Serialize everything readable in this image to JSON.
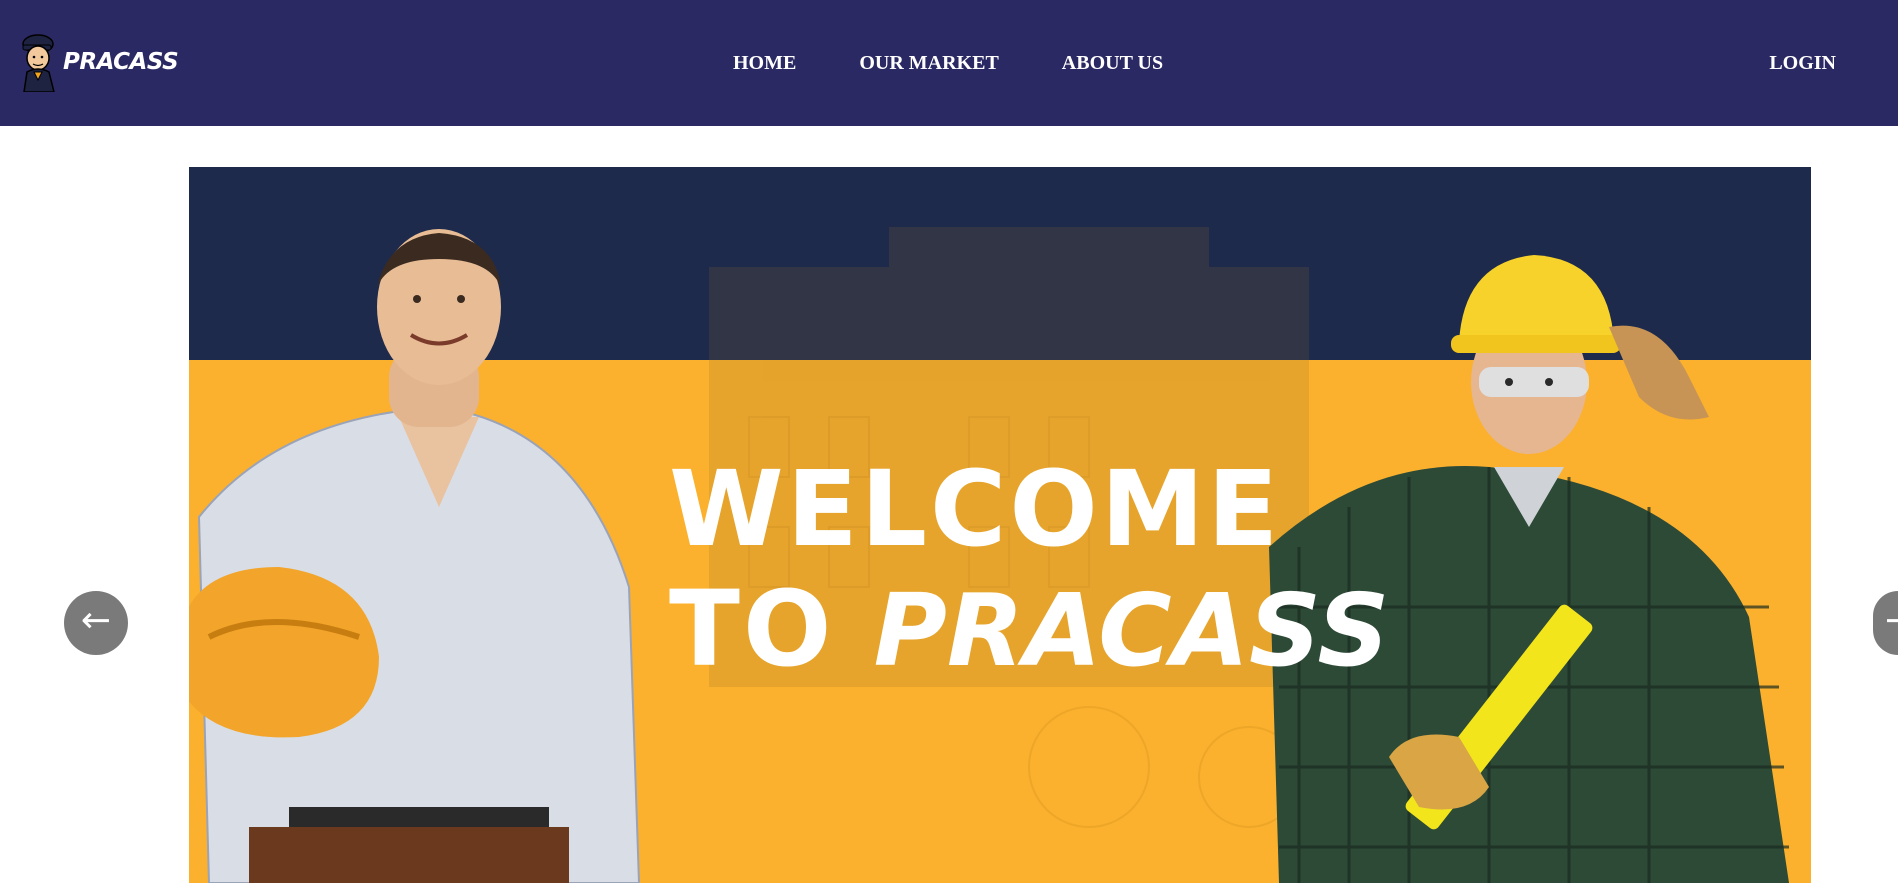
{
  "header": {
    "brand_name": "PRACASS",
    "nav": [
      {
        "label": "HOME"
      },
      {
        "label": "OUR MARKET"
      },
      {
        "label": "ABOUT US"
      }
    ],
    "login_label": "LOGIN",
    "background_color": "#2b2963"
  },
  "banner": {
    "headline_line1": "WELCOME",
    "headline_line2_prefix": "TO",
    "headline_line2_brand": "PRACASS",
    "primary_color": "#fbb12d",
    "top_band_color": "#1e2a4c"
  },
  "carousel": {
    "prev_icon": "←",
    "next_icon": "→"
  },
  "icons": {
    "logo": "worker-mascot-icon",
    "prev": "arrow-left-icon",
    "next": "arrow-right-icon"
  }
}
